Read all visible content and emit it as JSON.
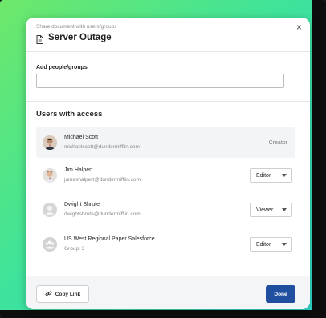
{
  "dialog": {
    "subtitle": "Share document with users/groups",
    "title": "Server Outage",
    "close_glyph": "×",
    "doc_icon": "document-icon"
  },
  "add": {
    "label": "Add people/groups",
    "value": "",
    "placeholder": ""
  },
  "access": {
    "heading": "Users with access",
    "users": [
      {
        "name": "Michael Scott",
        "email": "michaelscott@dundermifflin.com",
        "role": "Creator",
        "avatar": "photo"
      },
      {
        "name": "Jim Halpert",
        "email": "jameshalpert@dundermifflin.com",
        "role": "Editor",
        "avatar": "photo"
      },
      {
        "name": "Dwight Shrute",
        "email": "dwightshrute@dundermifflin.com",
        "role": "Viewer",
        "avatar": "user-placeholder-icon"
      },
      {
        "name": "US West Regional Paper Salesforce",
        "email": "Group: 3",
        "role": "Editor",
        "avatar": "group-icon"
      }
    ]
  },
  "footer": {
    "copy_label": "Copy Link",
    "done_label": "Done",
    "link_icon": "link-icon"
  },
  "colors": {
    "primary": "#1f4f9e",
    "backdrop_start": "#6ee86a",
    "backdrop_end": "#2fd6d0"
  }
}
